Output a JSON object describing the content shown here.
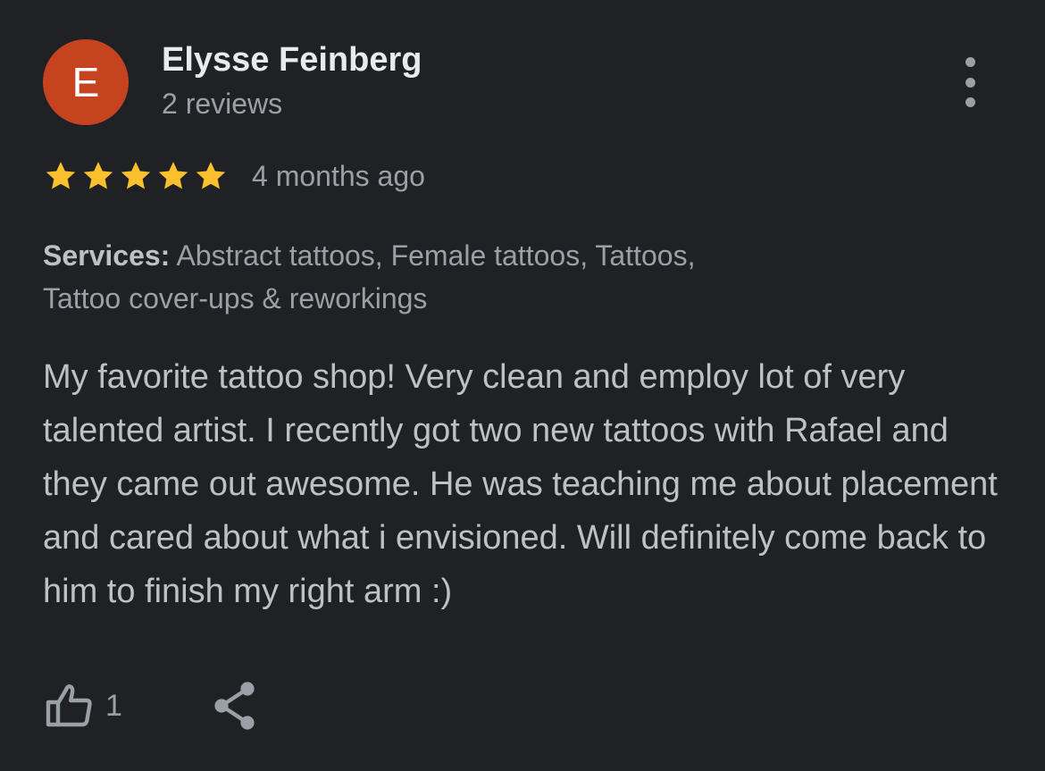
{
  "reviewer": {
    "initial": "E",
    "avatar_color": "#c5441f",
    "name": "Elysse Feinberg",
    "reviews_count": "2 reviews"
  },
  "menu": {
    "icon": "more-vert-icon"
  },
  "rating": {
    "stars": 5,
    "max_stars": 5,
    "star_color": "#fbc02d",
    "date": "4 months ago"
  },
  "services": {
    "label": "Services:",
    "line1": "Abstract tattoos, Female tattoos, Tattoos,",
    "line2": "Tattoo cover-ups & reworkings"
  },
  "review": {
    "text": "My favorite tattoo shop! Very clean and employ lot of very talented artist. I recently got two new tattoos with Rafael and they came out awesome. He was teaching me about placement and cared about what i envisioned. Will definitely come back to him to finish my right arm :)"
  },
  "actions": {
    "like_icon": "thumbs-up-icon",
    "like_count": "1",
    "share_icon": "share-icon"
  }
}
